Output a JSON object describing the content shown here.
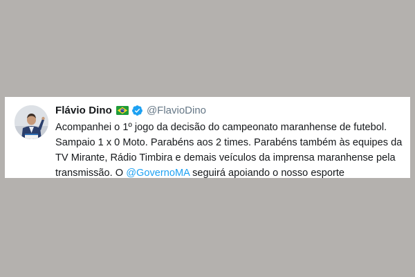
{
  "tweet": {
    "display_name": "Flávio Dino",
    "handle": "@FlavioDino",
    "flag_icon": "brazil-flag-icon",
    "verified_icon": "verified-badge-icon",
    "text_before_mention": "Acompanhei o 1º jogo da decisão do campeonato maranhense de futebol. Sampaio 1 x 0 Moto. Parabéns aos 2 times. Parabéns também às equipes da TV Mirante, Rádio Timbira e demais veículos da imprensa maranhense pela transmissão. O ",
    "mention": "@GovernoMA",
    "text_after_mention": " seguirá apoiando o nosso esporte"
  },
  "colors": {
    "background": "#b4b1ae",
    "card": "#ffffff",
    "text": "#14171a",
    "handle": "#657786",
    "link": "#1da1f2",
    "verified": "#1da1f2"
  }
}
